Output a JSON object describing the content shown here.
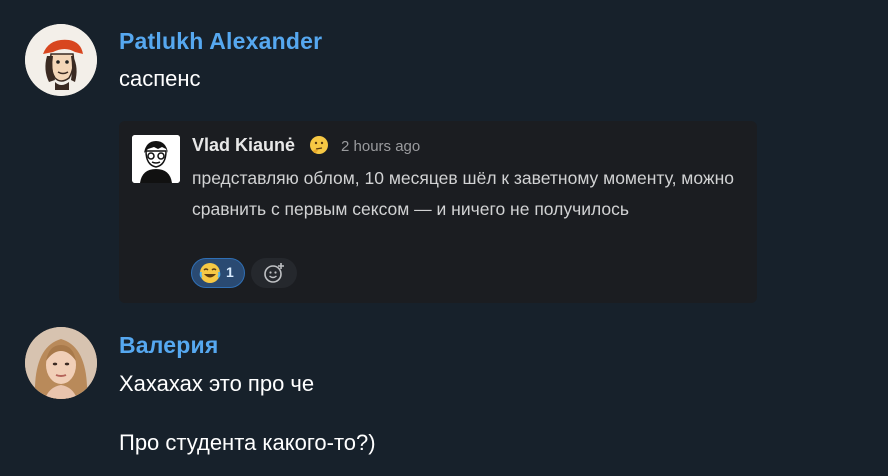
{
  "messages": [
    {
      "sender": "Patlukh Alexander",
      "text": "саспенс",
      "avatar": "pirate-avatar",
      "embed": {
        "name": "Vlad Kiaunė",
        "status_icon": "thinking-face-icon",
        "time": "2 hours ago",
        "text": "представляю облом, 10 месяцев шёл к заветному моменту, можно сравнить с первым сексом — и ничего не получилось",
        "reaction": {
          "emoji": "joy-icon",
          "count": "1"
        },
        "add_reaction_icon": "add-reaction-icon"
      }
    },
    {
      "sender": "Валерия",
      "lines": [
        "Хахахах это про че",
        "Про студента какого-то?)"
      ],
      "avatar": "woman-photo-avatar"
    }
  ],
  "colors": {
    "background": "#17212b",
    "sender": "#56a8f0",
    "embed_background": "#1b1d21",
    "reaction_background": "#2a4a72"
  }
}
